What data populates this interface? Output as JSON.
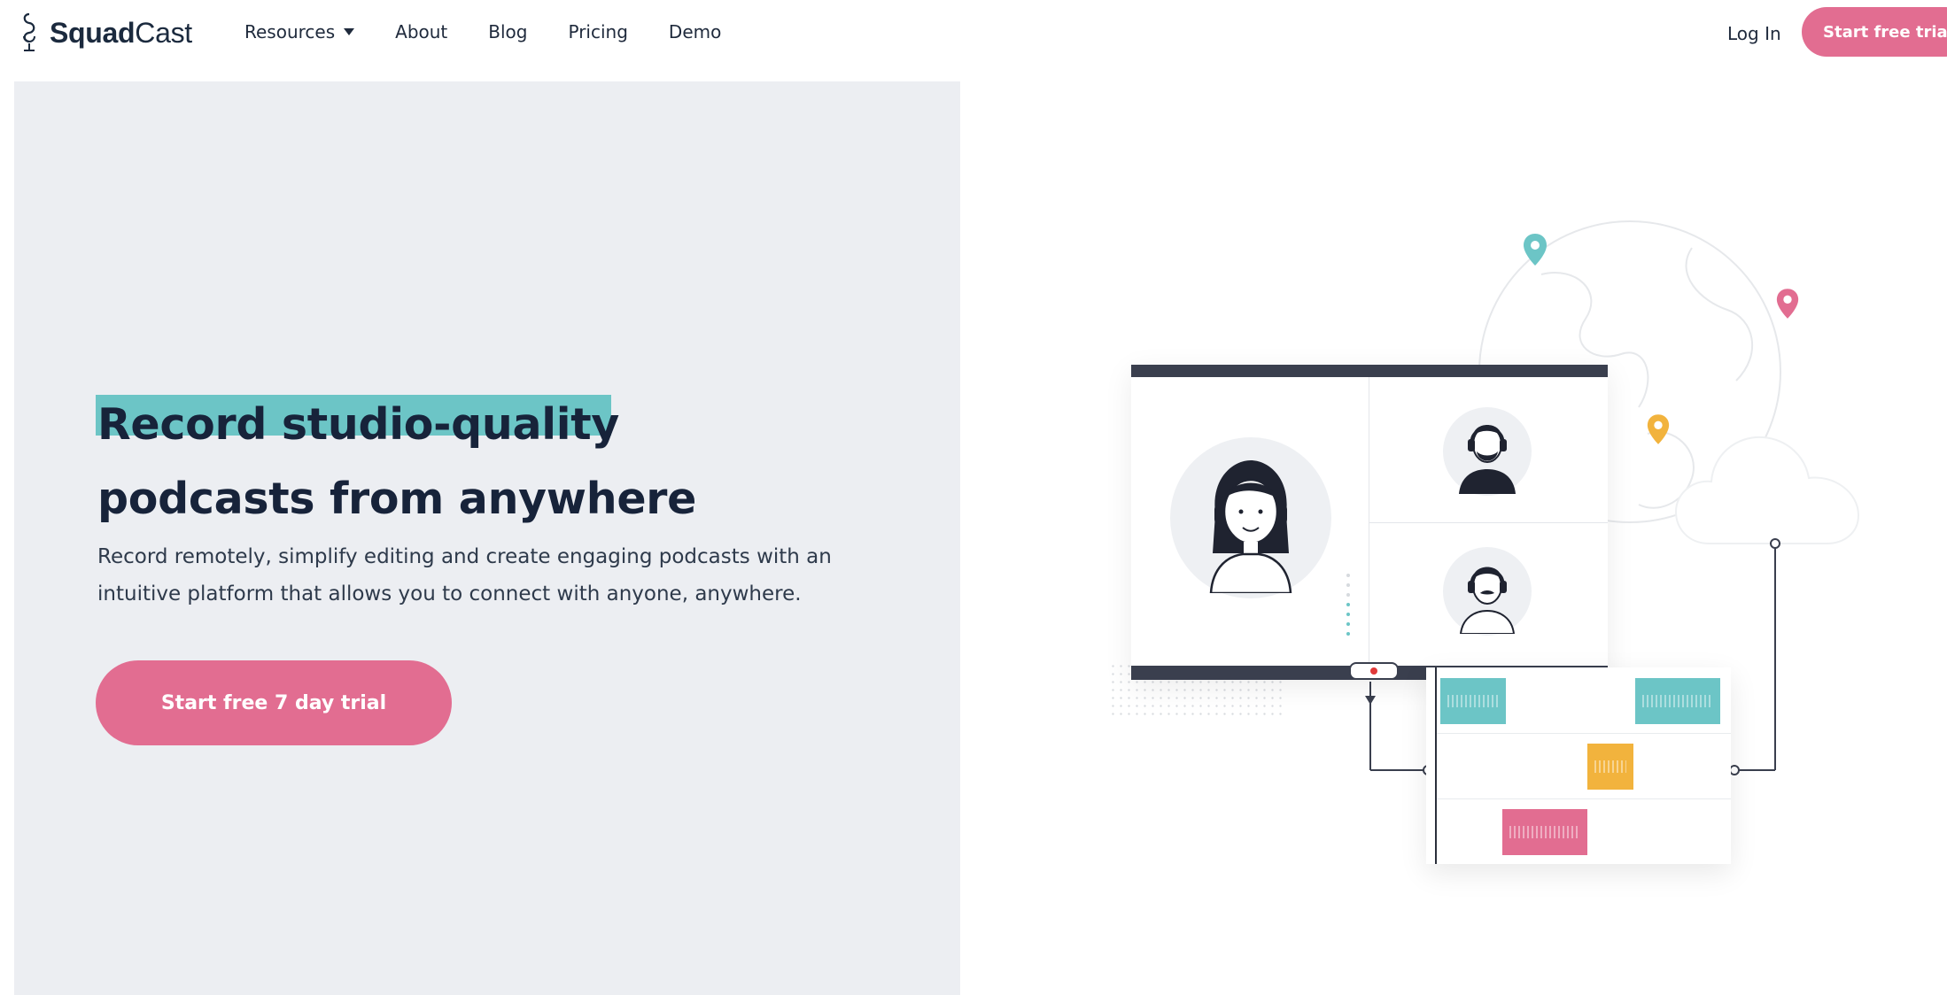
{
  "nav": {
    "brand_bold": "Squad",
    "brand_light": "Cast",
    "items": [
      {
        "label": "Resources",
        "has_dropdown": true
      },
      {
        "label": "About"
      },
      {
        "label": "Blog"
      },
      {
        "label": "Pricing"
      },
      {
        "label": "Demo"
      }
    ],
    "login_label": "Log In",
    "cta_label": "Start free trial"
  },
  "hero": {
    "headline_line1": "Record studio-quality",
    "headline_line2": "podcasts from anywhere",
    "subtext": "Record remotely, simplify editing and create engaging podcasts with an intuitive platform that allows you to connect with anyone, anywhere.",
    "cta_label": "Start free 7 day trial"
  },
  "colors": {
    "accent_pink": "#e26d91",
    "accent_teal": "#6cc5c6",
    "accent_yellow": "#f2b33d",
    "panel_bg": "#eceef2",
    "text_dark": "#17233a"
  },
  "icons": {
    "logo": "microphone-icon",
    "dropdown": "caret-down-icon",
    "pins": [
      "map-pin-icon",
      "map-pin-icon",
      "map-pin-icon"
    ],
    "cloud": "cloud-icon",
    "record": "record-dot-icon"
  }
}
